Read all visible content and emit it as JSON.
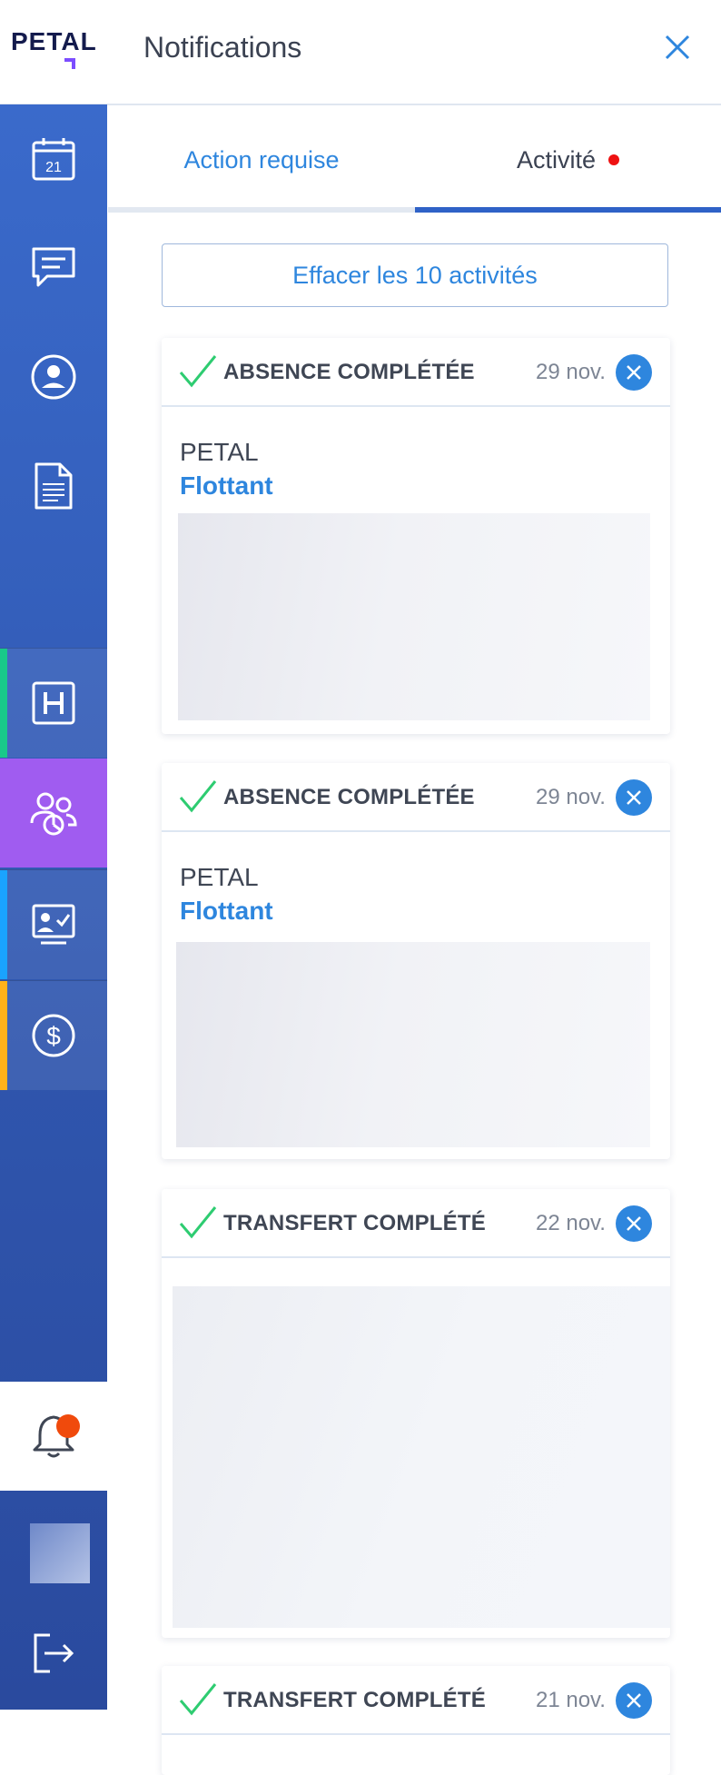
{
  "header": {
    "logo_text": "PETAL",
    "title": "Notifications",
    "close_icon": "close-icon"
  },
  "sidebar": {
    "items": [
      {
        "name": "calendar",
        "icon": "calendar-icon",
        "day": "21"
      },
      {
        "name": "messages",
        "icon": "chat-icon"
      },
      {
        "name": "profile",
        "icon": "user-icon"
      },
      {
        "name": "documents",
        "icon": "document-icon"
      },
      {
        "name": "hospital",
        "icon": "hospital-icon",
        "accent": "#19c98a"
      },
      {
        "name": "team",
        "icon": "team-icon",
        "active_color": "#a05cf0"
      },
      {
        "name": "timesheet",
        "icon": "presentation-check-icon",
        "accent": "#1aa3ff"
      },
      {
        "name": "payroll",
        "icon": "dollar-icon",
        "accent": "#ffb21a"
      },
      {
        "name": "notifications",
        "icon": "bell-icon"
      },
      {
        "name": "logout",
        "icon": "logout-icon"
      }
    ]
  },
  "tabs": {
    "action_label": "Action requise",
    "activity_label": "Activité"
  },
  "clear_button_label": "Effacer les 10 activités",
  "cards": [
    {
      "title": "ABSENCE COMPLÉTÉE",
      "date": "29 nov.",
      "org": "PETAL",
      "subtitle": "Flottant"
    },
    {
      "title": "ABSENCE COMPLÉTÉE",
      "date": "29 nov.",
      "org": "PETAL",
      "subtitle": "Flottant"
    },
    {
      "title": "TRANSFERT COMPLÉTÉ",
      "date": "22 nov."
    },
    {
      "title": "TRANSFERT COMPLÉTÉ",
      "date": "21 nov."
    }
  ],
  "colors": {
    "accent_blue": "#2e86de",
    "sidebar_blue": "#3a6acb",
    "check_green": "#2ecc71",
    "notification_red": "#ee1111",
    "bell_badge": "#f04a0c"
  }
}
